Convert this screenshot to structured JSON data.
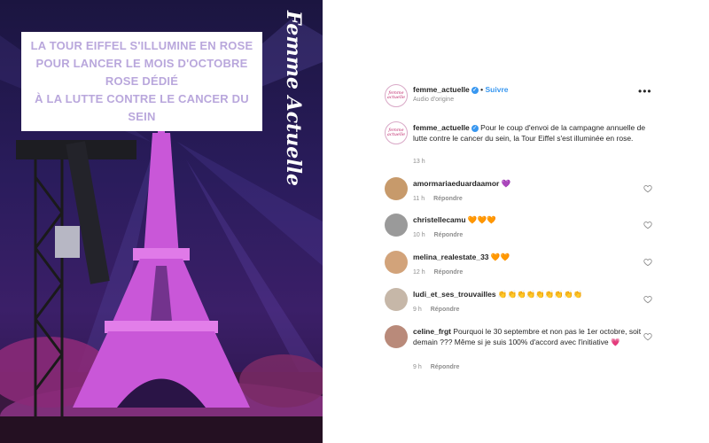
{
  "media": {
    "caption_lines": [
      "LA TOUR EIFFEL S'ILLUMINE EN ROSE",
      "POUR LANCER LE MOIS D'OCTOBRE ROSE DÉDIÉ",
      "À LA LUTTE CONTRE LE CANCER DU SEIN"
    ],
    "brand_overlay": "Femme Actuelle"
  },
  "post": {
    "header": {
      "username": "femme_actuelle",
      "follow_label": "Suivre",
      "audio_label": "Audio d'origine",
      "avatar_text": "femme actuelle"
    },
    "caption": {
      "username": "femme_actuelle",
      "text": "Pour le coup d'envoi de la campagne annuelle de lutte contre le cancer du sein, la Tour Eiffel s'est illuminée en rose.",
      "time": "13 h"
    },
    "comments": [
      {
        "username": "amormariaeduardaamor",
        "text": "💜",
        "time": "11 h",
        "reply": "Répondre",
        "avatar_color": "#c79a6b"
      },
      {
        "username": "christellecamu",
        "text": "🧡🧡🧡",
        "time": "10 h",
        "reply": "Répondre",
        "avatar_color": "#9a9a9a"
      },
      {
        "username": "melina_realestate_33",
        "text": "🧡🧡",
        "time": "12 h",
        "reply": "Répondre",
        "avatar_color": "#d2a37a"
      },
      {
        "username": "ludi_et_ses_trouvailles",
        "text": "👏👏👏👏👏👏👏👏👏",
        "time": "9 h",
        "reply": "Répondre",
        "avatar_color": "#c6b7a8"
      },
      {
        "username": "celine_frgt",
        "text": "Pourquoi le 30 septembre et non pas le 1er octobre, soit demain ??? Même si je suis 100% d'accord avec l'initiative 💗",
        "time": "9 h",
        "reply": "Répondre",
        "avatar_color": "#b98a7a"
      }
    ]
  },
  "colors": {
    "accent_blue": "#3897f0",
    "caption_text": "#b9a7dc",
    "tower_pink": "#c957d8"
  }
}
